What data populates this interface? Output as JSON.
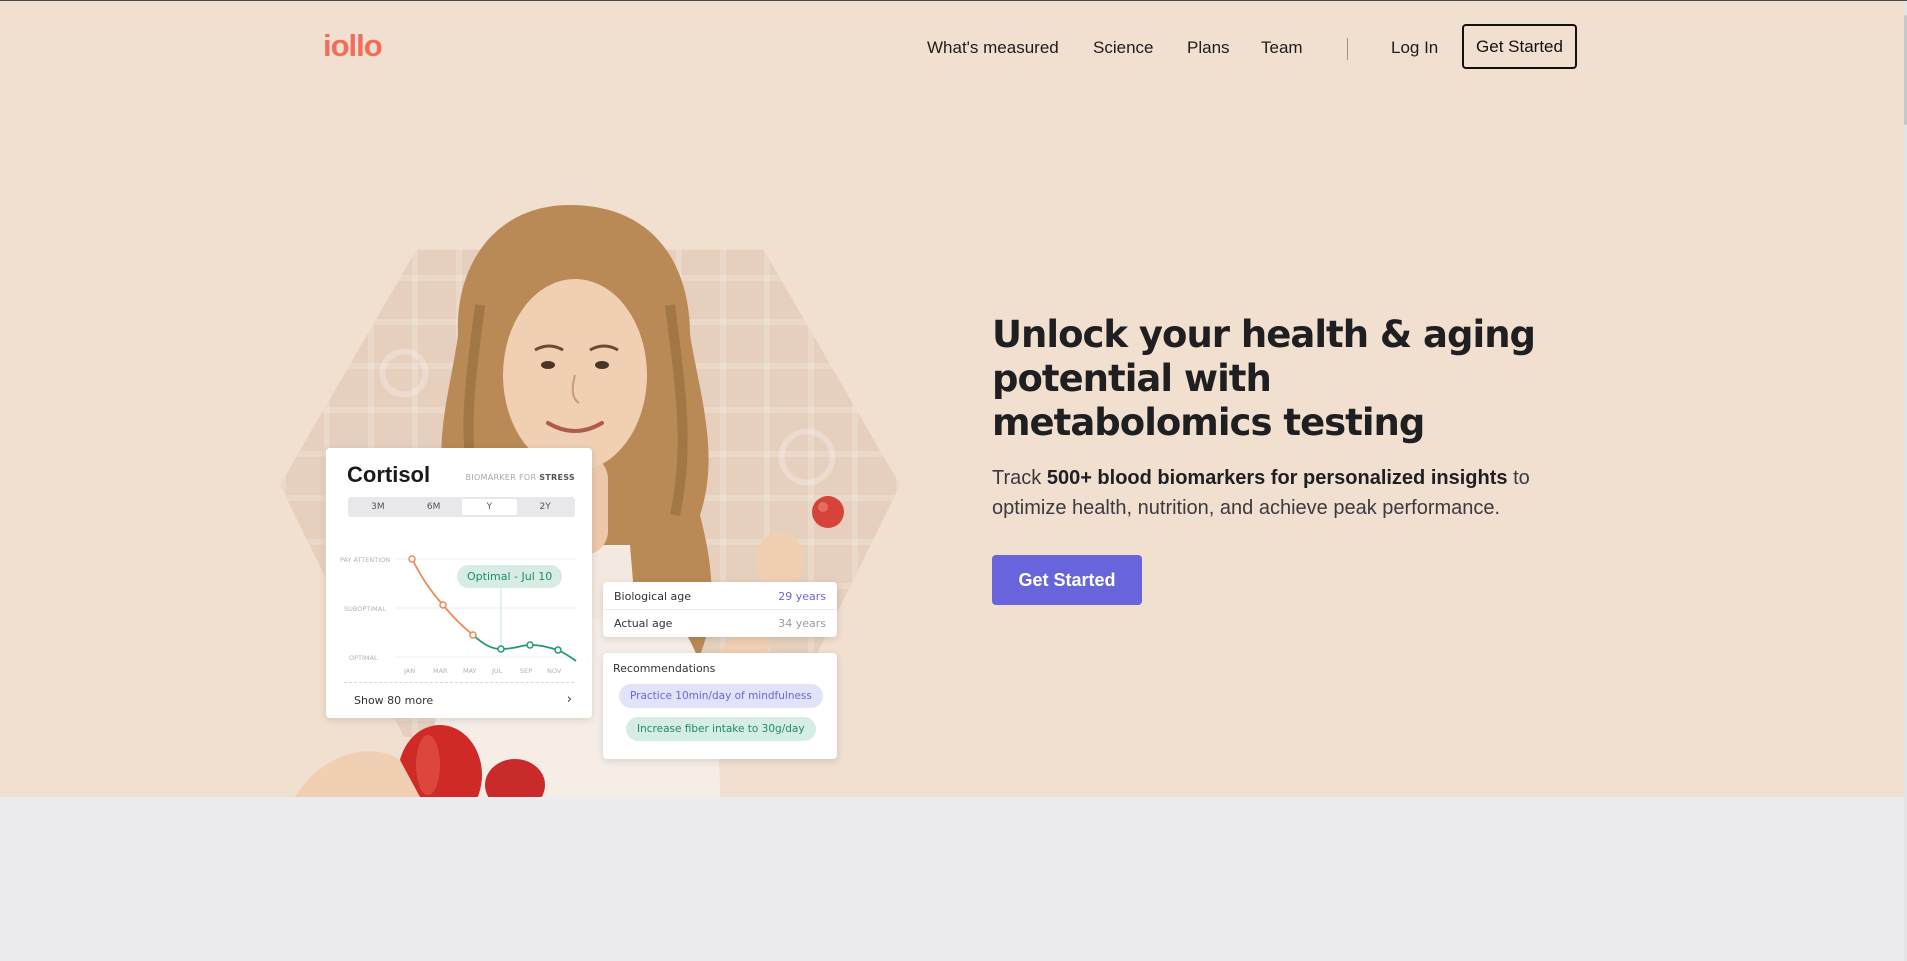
{
  "brand": {
    "logo_text": "iollo",
    "logo_color": "#f26d5b"
  },
  "nav": {
    "items": [
      "What's measured",
      "Science",
      "Plans",
      "Team"
    ],
    "login_label": "Log In",
    "cta_label": "Get Started"
  },
  "hero": {
    "headline": "Unlock your health & aging potential with metabolomics testing",
    "sub_pre": "Track ",
    "sub_bold": "500+ blood biomarkers for personalized insights",
    "sub_post": " to optimize health, nutrition, and achieve peak performance.",
    "cta_label": "Get Started",
    "cta_color": "#6865dc",
    "background_color": "#f1dfd0"
  },
  "biomarker_card": {
    "title": "Cortisol",
    "subtitle_prefix": "BIOMARKER FOR ",
    "subtitle_emphasis": "STRESS",
    "ranges": [
      "3M",
      "6M",
      "Y",
      "2Y"
    ],
    "active_range": "Y",
    "zones": [
      "PAY ATTENTION",
      "SUBOPTIMAL",
      "OPTIMAL"
    ],
    "months": [
      "JAN",
      "MAR",
      "MAY",
      "JUL",
      "SEP",
      "NOV"
    ],
    "callout": "Optimal - Jul 10",
    "show_more": "Show 80 more",
    "line_colors": {
      "attention": "#ee8a55",
      "optimal": "#1f9a72"
    }
  },
  "age_card": {
    "rows": [
      {
        "label": "Biological age",
        "value": "29 years",
        "value_color": "#6c65d8"
      },
      {
        "label": "Actual age",
        "value": "34 years",
        "value_color": "#9a9aa2"
      }
    ]
  },
  "recommendations": {
    "title": "Recommendations",
    "items": [
      "Practice 10min/day of mindfulness",
      "Increase fiber intake to 30g/day"
    ]
  }
}
